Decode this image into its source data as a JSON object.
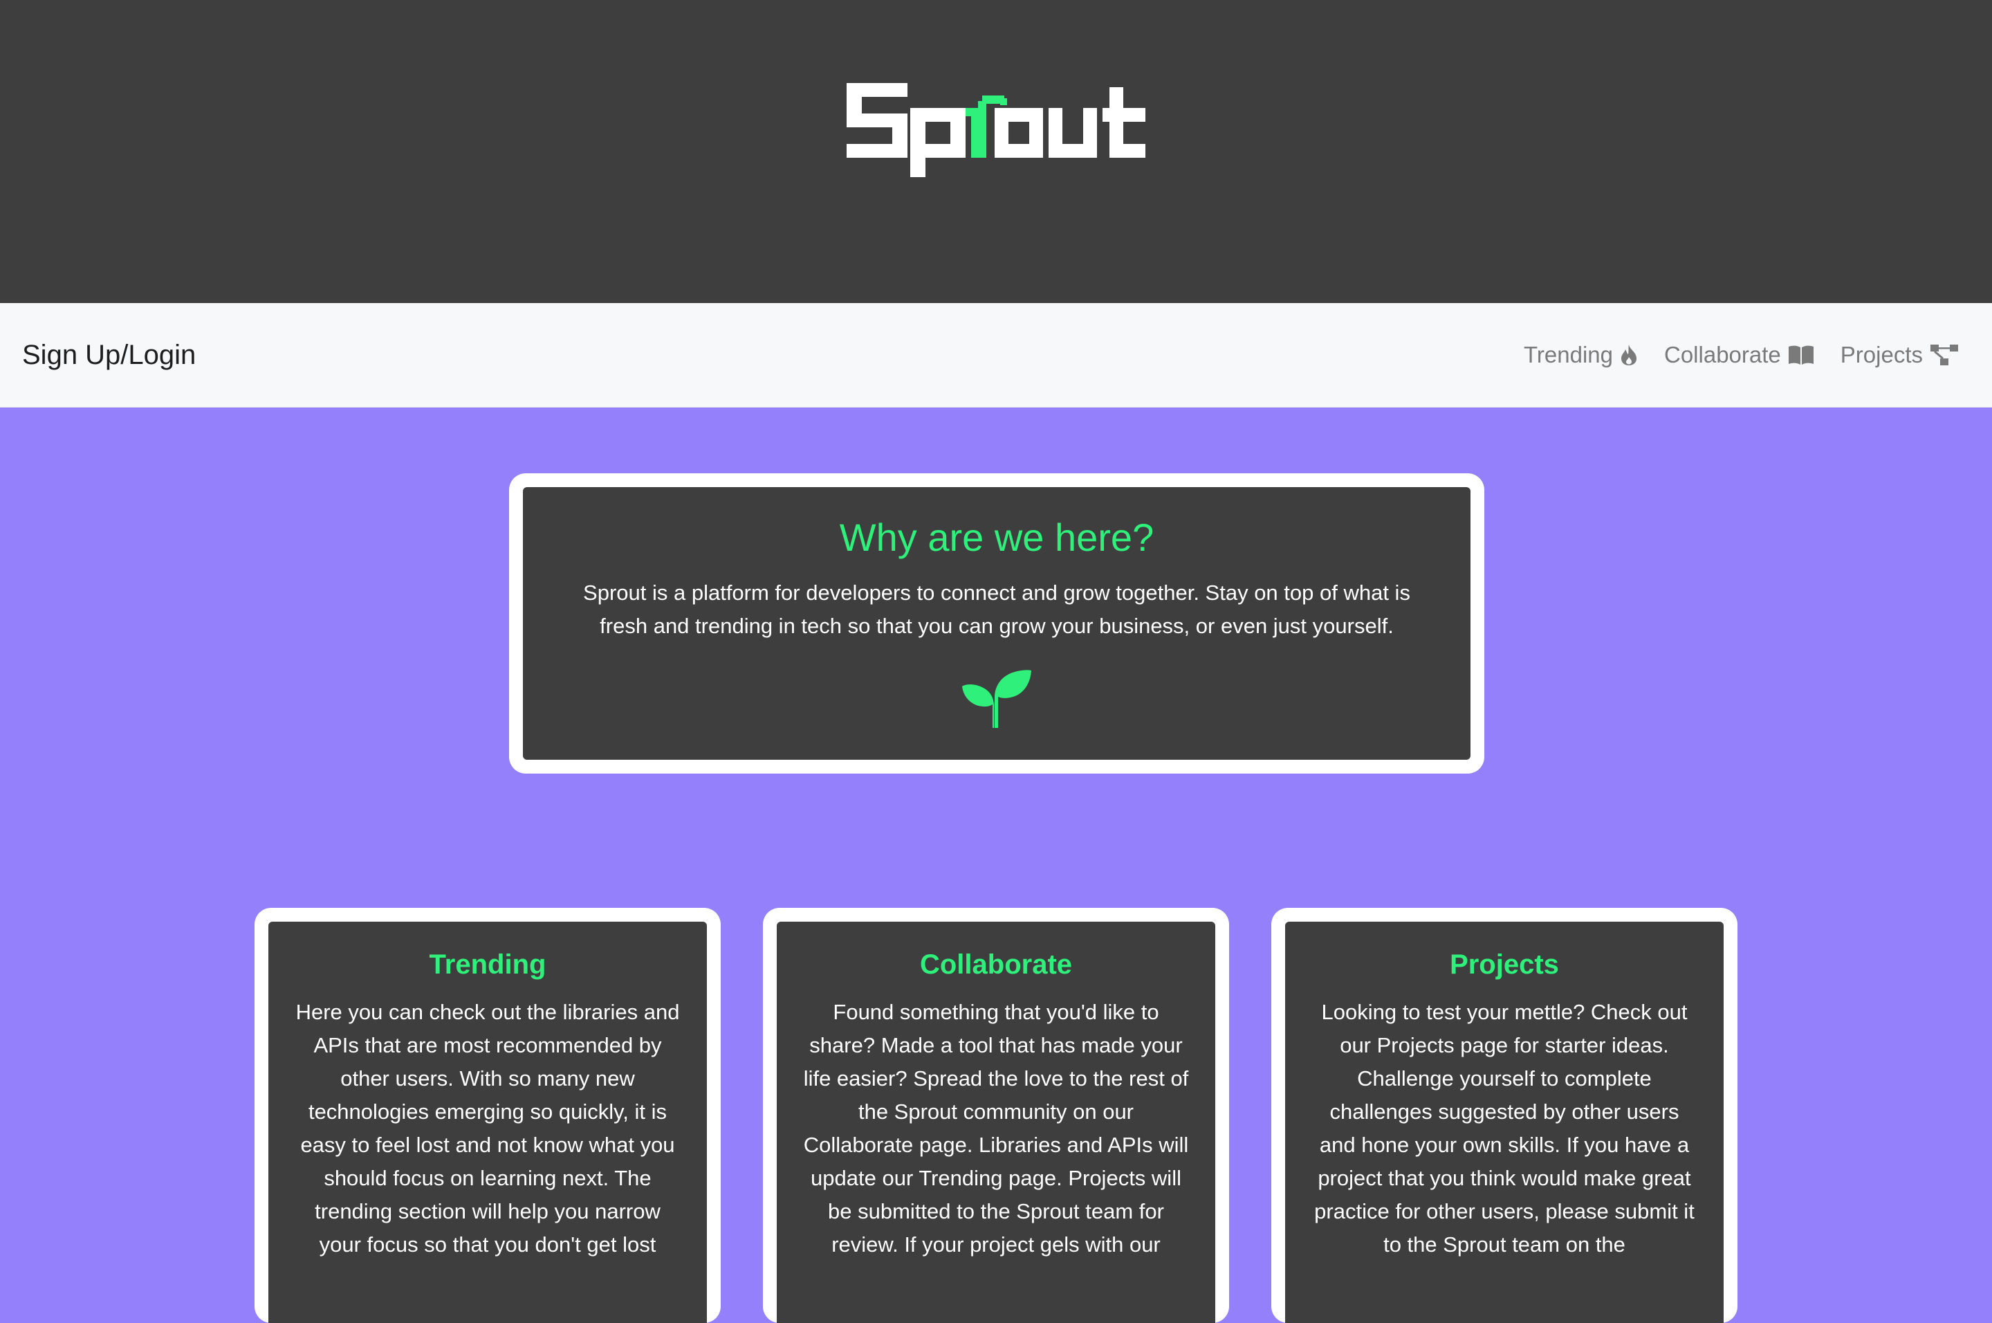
{
  "colors": {
    "header_bg": "#3e3e3e",
    "navbar_bg": "#f7f8f9",
    "page_bg": "#9380fa",
    "accent_green": "#2ef07a",
    "card_bg": "#3e3e3e",
    "card_border": "#ffffff"
  },
  "header": {
    "logo_text": "Sprout"
  },
  "navbar": {
    "brand": "Sign Up/Login",
    "links": [
      {
        "label": "Trending",
        "icon": "fire-icon"
      },
      {
        "label": "Collaborate",
        "icon": "book-icon"
      },
      {
        "label": "Projects",
        "icon": "diagram-icon"
      }
    ]
  },
  "intro": {
    "title": "Why are we here?",
    "text": "Sprout is a platform for developers to connect and grow together. Stay on top of what is fresh and trending in tech so that you can grow your business, or even just yourself.",
    "icon": "sprout-icon"
  },
  "features": [
    {
      "title": "Trending",
      "text": "Here you can check out the libraries and APIs that are most recommended by other users. With so many new technologies emerging so quickly, it is easy to feel lost and not know what you should focus on learning next. The trending section will help you narrow your focus so that you don't get lost"
    },
    {
      "title": "Collaborate",
      "text": "Found something that you'd like to share? Made a tool that has made your life easier? Spread the love to the rest of the Sprout community on our Collaborate page. Libraries and APIs will update our Trending page. Projects will be submitted to the Sprout team for review. If your project gels with our"
    },
    {
      "title": "Projects",
      "text": "Looking to test your mettle? Check out our Projects page for starter ideas. Challenge yourself to complete challenges suggested by other users and hone your own skills. If you have a project that you think would make great practice for other users, please submit it to the Sprout team on the"
    }
  ]
}
